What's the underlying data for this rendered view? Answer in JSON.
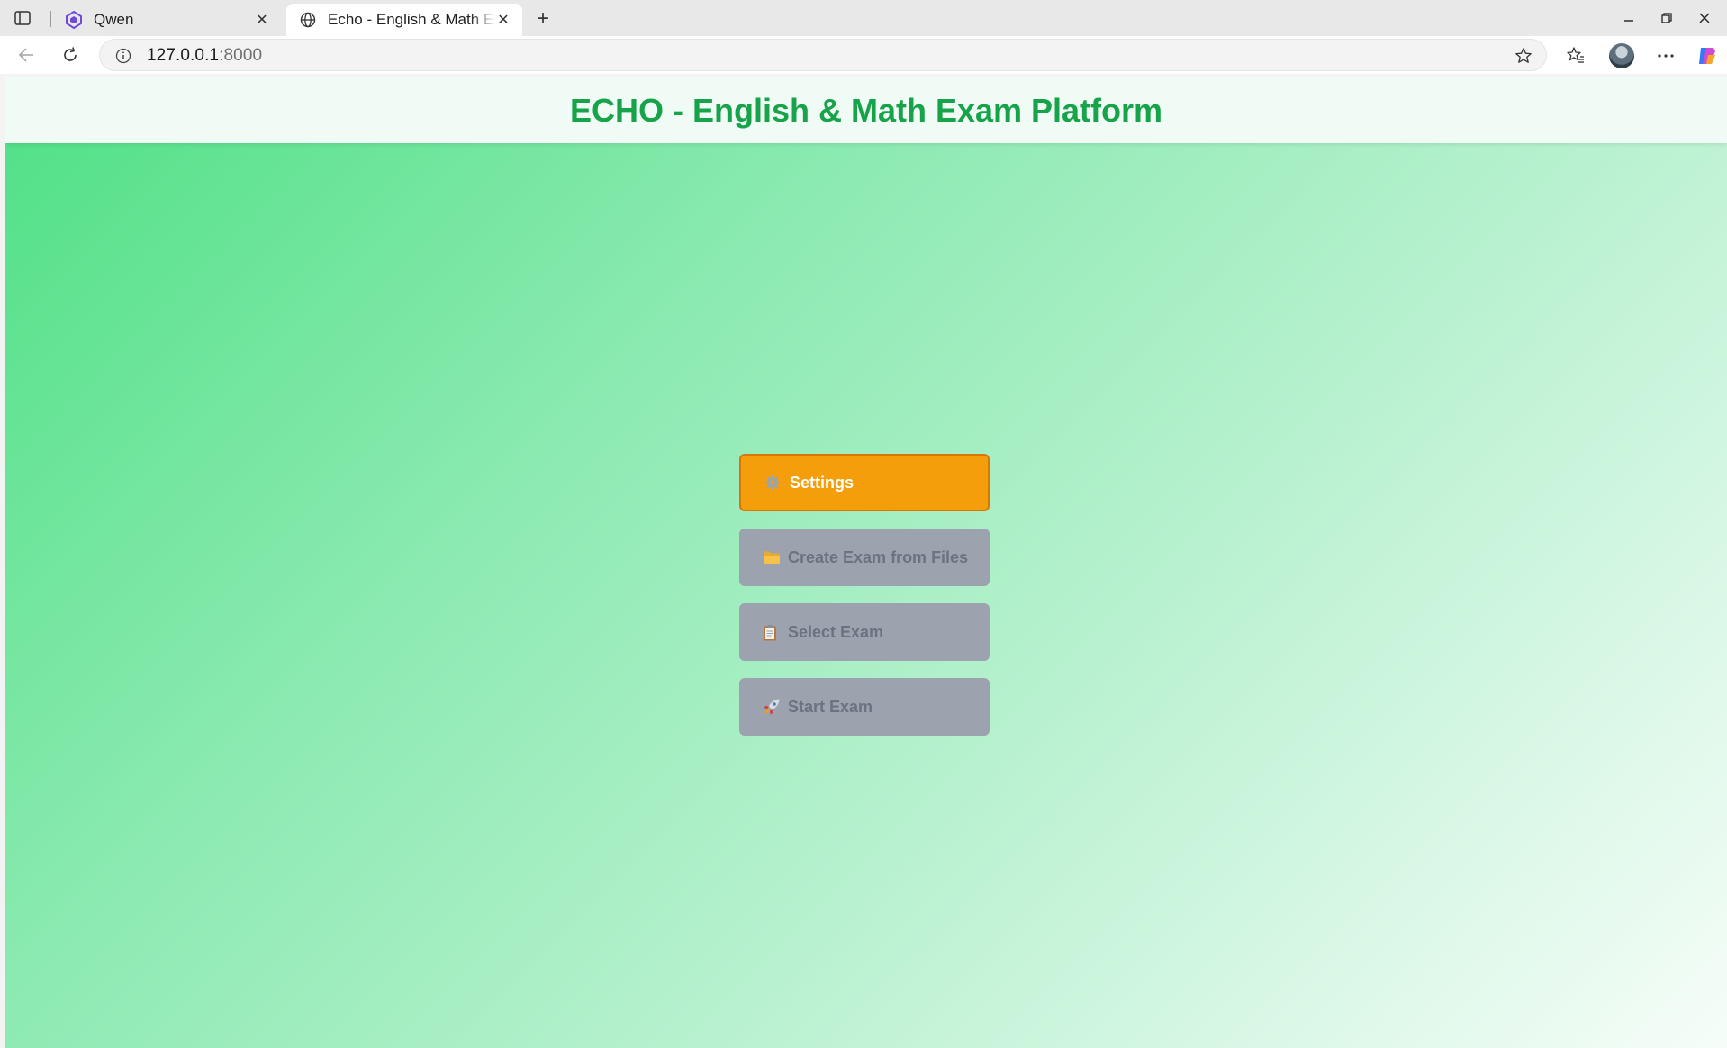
{
  "browser": {
    "tabs": [
      {
        "title": "Qwen",
        "icon": "qwen-logo-icon",
        "active": false
      },
      {
        "title": "Echo - English & Math Exam Platform",
        "icon": "globe-icon",
        "active": true
      }
    ],
    "address": {
      "host": "127.0.0.1",
      "port": ":8000"
    }
  },
  "page": {
    "title": "ECHO - English & Math Exam Platform",
    "menu": [
      {
        "label": "Settings",
        "icon": "gear-icon",
        "state": "active"
      },
      {
        "label": "Create Exam from Files",
        "icon": "folder-icon",
        "state": "disabled"
      },
      {
        "label": "Select Exam",
        "icon": "clipboard-icon",
        "state": "disabled"
      },
      {
        "label": "Start Exam",
        "icon": "rocket-icon",
        "state": "disabled"
      }
    ]
  },
  "colors": {
    "title_green": "#16a34a",
    "primary_button": "#f59e0b",
    "disabled_button": "#9ca3af"
  }
}
